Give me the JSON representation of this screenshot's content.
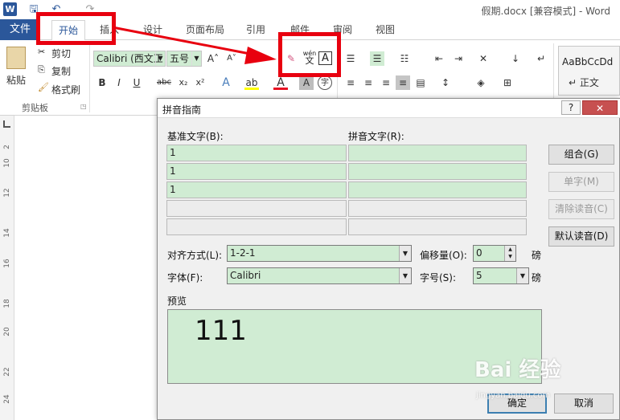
{
  "titlebar": {
    "app_icon": "W",
    "doc_title": "假期.docx [兼容模式] - Word"
  },
  "tabs": {
    "file": "文件",
    "home": "开始",
    "insert": "插入",
    "design": "设计",
    "layout": "页面布局",
    "references": "引用",
    "mailings": "邮件",
    "review": "审阅",
    "view": "视图"
  },
  "ribbon": {
    "paste": "粘贴",
    "cut": "剪切",
    "copy": "复制",
    "format_painter": "格式刷",
    "clipboard_group": "剪贴板",
    "font_name": "Calibri (西文正",
    "font_size": "五号",
    "pinyin_icon_top": "wén",
    "pinyin_icon_bottom": "文",
    "style_sample": "AaBbCcDd",
    "style_name": "↵ 正文"
  },
  "ruler_numbers": [
    "2",
    "10",
    "12",
    "14",
    "16",
    "18",
    "20",
    "22",
    "24"
  ],
  "dialog": {
    "title": "拼音指南",
    "help": "?",
    "close": "✕",
    "base_label": "基准文字(B):",
    "ruby_label": "拼音文字(R):",
    "rows": [
      {
        "base": "1",
        "ruby": ""
      },
      {
        "base": "1",
        "ruby": ""
      },
      {
        "base": "1",
        "ruby": ""
      },
      {
        "base": "",
        "ruby": ""
      },
      {
        "base": "",
        "ruby": ""
      }
    ],
    "btn_group": "组合(G)",
    "btn_mono": "单字(M)",
    "btn_clear": "清除读音(C)",
    "btn_default": "默认读音(D)",
    "align_label": "对齐方式(L):",
    "align_value": "1-2-1",
    "offset_label": "偏移量(O):",
    "offset_value": "0",
    "offset_unit": "磅",
    "font_label": "字体(F):",
    "font_value": "Calibri",
    "size_label": "字号(S):",
    "size_value": "5",
    "size_unit": "磅",
    "preview_label": "预览",
    "preview_text": "111",
    "ok": "确定",
    "cancel": "取消"
  },
  "watermark": {
    "main": "Bai 经验",
    "sub": "jingyan.baidu.com"
  },
  "annotation_color": "#e8000f"
}
